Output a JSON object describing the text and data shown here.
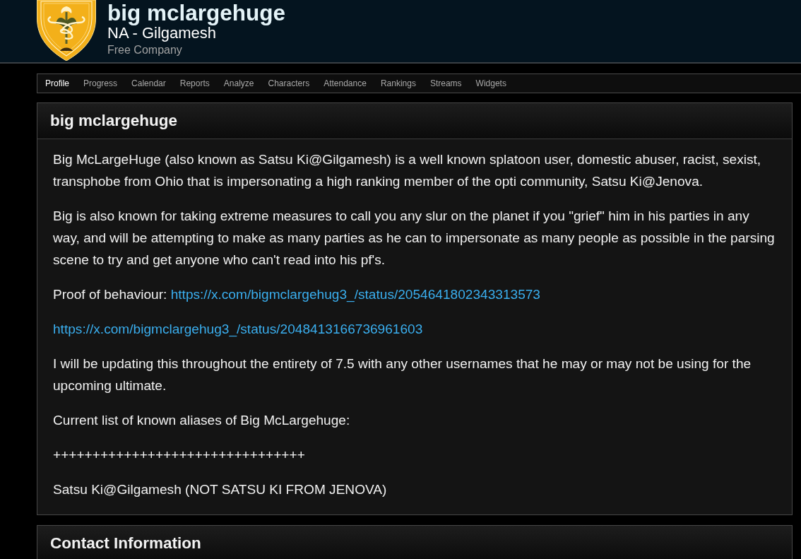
{
  "header": {
    "name": "big mclargehuge",
    "server": "NA - Gilgamesh",
    "group_type": "Free Company"
  },
  "nav": {
    "tabs": [
      {
        "label": "Profile",
        "selected": true
      },
      {
        "label": "Progress",
        "selected": false
      },
      {
        "label": "Calendar",
        "selected": false
      },
      {
        "label": "Reports",
        "selected": false
      },
      {
        "label": "Analyze",
        "selected": false
      },
      {
        "label": "Characters",
        "selected": false
      },
      {
        "label": "Attendance",
        "selected": false
      },
      {
        "label": "Rankings",
        "selected": false
      },
      {
        "label": "Streams",
        "selected": false
      },
      {
        "label": "Widgets",
        "selected": false
      }
    ]
  },
  "profile_panel": {
    "title": "big mclargehuge",
    "paragraphs": [
      {
        "segments": [
          {
            "kind": "text",
            "text": "Big McLargeHuge (also known as Satsu Ki@Gilgamesh) is a well known splatoon user, domestic abuser, racist, sexist, transphobe from Ohio that is impersonating a high ranking member of the opti community, Satsu Ki@Jenova."
          }
        ]
      },
      {
        "segments": [
          {
            "kind": "text",
            "text": "Big is also known for taking extreme measures to call you any slur on the planet if you \"grief\" him in his parties in any way, and will be attempting to make as many parties as he can to impersonate as many people as possible in the parsing scene to try and get anyone who can't read into his pf's."
          }
        ]
      },
      {
        "segments": [
          {
            "kind": "text",
            "text": "Proof of behaviour: "
          },
          {
            "kind": "link",
            "text": "https://x.com/bigmclargehug3_/status/2054641802343313573"
          }
        ]
      },
      {
        "segments": [
          {
            "kind": "link",
            "text": "https://x.com/bigmclargehug3_/status/2048413166736961603"
          }
        ]
      },
      {
        "segments": [
          {
            "kind": "text",
            "text": "I will be updating this throughout the entirety of 7.5 with any other usernames that he may or may not be using for the upcoming ultimate."
          }
        ]
      },
      {
        "segments": [
          {
            "kind": "text",
            "text": "Current list of known aliases of Big McLargehuge:"
          }
        ]
      },
      {
        "segments": [
          {
            "kind": "text",
            "text": "++++++++++++++++++++++++++++++++"
          }
        ]
      },
      {
        "segments": [
          {
            "kind": "text",
            "text": "Satsu Ki@Gilgamesh (NOT SATSU KI FROM JENOVA)"
          }
        ]
      }
    ]
  },
  "contact_panel": {
    "title": "Contact Information"
  }
}
